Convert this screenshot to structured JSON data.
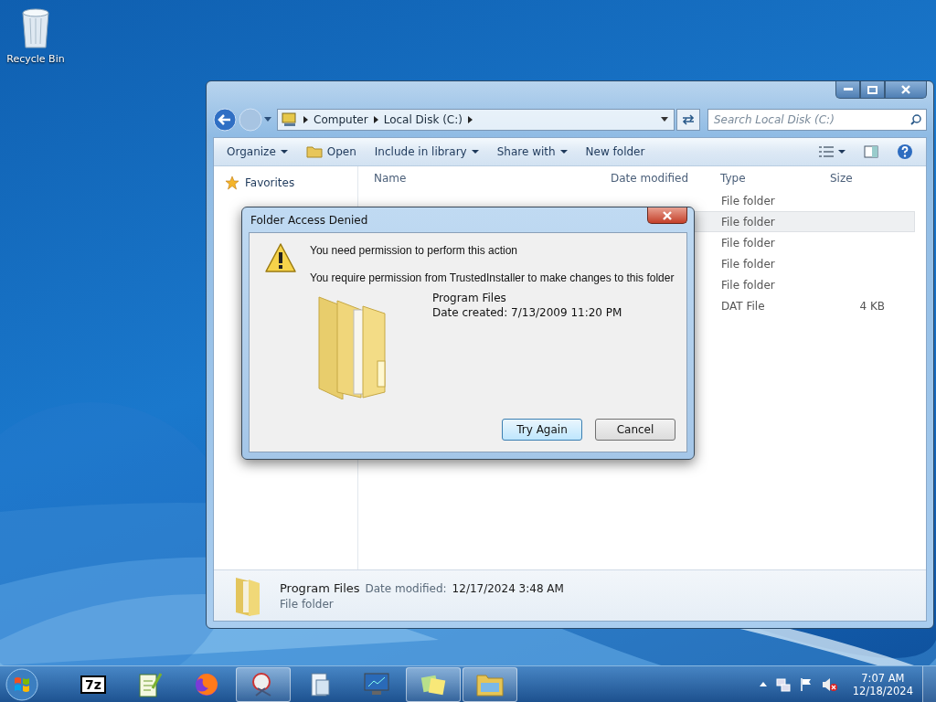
{
  "desktop": {
    "icons": [
      {
        "label": "Recycle Bin",
        "kind": "recycle"
      }
    ]
  },
  "explorer": {
    "address": [
      "Computer",
      "Local Disk (C:)"
    ],
    "search": {
      "placeholder": "Search Local Disk (C:)"
    },
    "toolbar": [
      {
        "label": "Organize",
        "kind": "menu"
      },
      {
        "label": "Open",
        "kind": "icon"
      },
      {
        "label": "Include in library",
        "kind": "menu"
      },
      {
        "label": "Share with",
        "kind": "menu"
      },
      {
        "label": "New folder",
        "kind": "plain"
      }
    ],
    "nav": [
      {
        "label": "Favorites"
      }
    ],
    "columns": [
      "Name",
      "Date modified",
      "Type",
      "Size"
    ],
    "rows": [
      {
        "type": "File folder",
        "selected": false
      },
      {
        "type": "File folder",
        "selected": true
      },
      {
        "type": "File folder",
        "selected": false
      },
      {
        "type": "File folder",
        "selected": false
      },
      {
        "type": "File folder",
        "selected": false
      },
      {
        "type": "DAT File",
        "size": "4 KB",
        "selected": false
      }
    ],
    "details": {
      "name": "Program Files",
      "label": "Date modified:",
      "date": "12/17/2024 3:48 AM",
      "type": "File folder"
    }
  },
  "dialog": {
    "title": "Folder Access Denied",
    "heading": "You need permission to perform this action",
    "message": "You require permission from TrustedInstaller to make changes to this folder",
    "item_name": "Program Files",
    "item_date": "Date created: 7/13/2009 11:20 PM",
    "buttons": [
      {
        "label": "Try Again",
        "default": true
      },
      {
        "label": "Cancel",
        "default": false
      }
    ]
  },
  "taskbar": {
    "apps": [
      {
        "kind": "archiver",
        "label": "7z",
        "active": false
      },
      {
        "kind": "notepad",
        "active": false
      },
      {
        "kind": "browser",
        "active": false
      },
      {
        "kind": "snip",
        "active": true
      },
      {
        "kind": "document",
        "active": false
      },
      {
        "kind": "monitor",
        "active": false
      },
      {
        "kind": "notes",
        "active": true
      },
      {
        "kind": "folder",
        "active": true
      }
    ],
    "time": "7:07 AM",
    "date": "12/18/2024"
  }
}
